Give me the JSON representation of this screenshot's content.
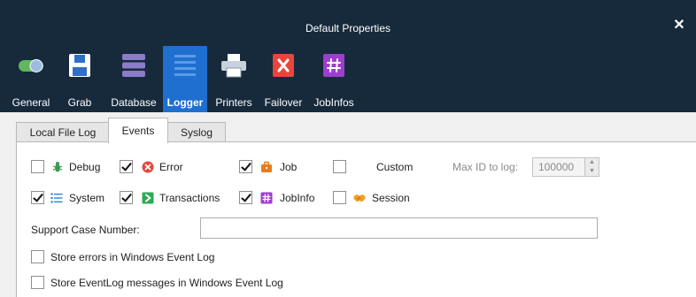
{
  "window": {
    "title": "Default Properties",
    "close_glyph": "✕"
  },
  "toolbar": {
    "items": [
      {
        "label": "General",
        "icon": "toggle-icon"
      },
      {
        "label": "Grab",
        "icon": "floppy-disk-icon"
      },
      {
        "label": "Database",
        "icon": "database-icon"
      },
      {
        "label": "Logger",
        "icon": "log-list-icon",
        "active": true
      },
      {
        "label": "Printers",
        "icon": "printer-icon"
      },
      {
        "label": "Failover",
        "icon": "failover-x-icon"
      },
      {
        "label": "JobInfos",
        "icon": "hash-icon"
      }
    ],
    "active_color": "#1e6fcf"
  },
  "tabs": [
    {
      "label": "Local File Log"
    },
    {
      "label": "Events",
      "active": true
    },
    {
      "label": "Syslog"
    }
  ],
  "events": {
    "debug": {
      "label": "Debug",
      "checked": false,
      "icon": "bug-icon"
    },
    "error": {
      "label": "Error",
      "checked": true,
      "icon": "error-icon"
    },
    "job": {
      "label": "Job",
      "checked": true,
      "icon": "briefcase-icon"
    },
    "custom": {
      "label": "Custom",
      "checked": false
    },
    "system": {
      "label": "System",
      "checked": true,
      "icon": "list-icon"
    },
    "transactions": {
      "label": "Transactions",
      "checked": true,
      "icon": "transactions-arrow-icon"
    },
    "jobinfo": {
      "label": "JobInfo",
      "checked": true,
      "icon": "hash-icon"
    },
    "session": {
      "label": "Session",
      "checked": false,
      "icon": "handshake-icon"
    }
  },
  "max_id": {
    "label": "Max ID to log:",
    "value": "100000"
  },
  "support_case": {
    "label": "Support Case Number:",
    "value": ""
  },
  "options": {
    "store_errors": {
      "label": "Store errors in Windows Event Log",
      "checked": false
    },
    "store_eventlog": {
      "label": "Store EventLog messages in Windows Event Log",
      "checked": false
    }
  }
}
